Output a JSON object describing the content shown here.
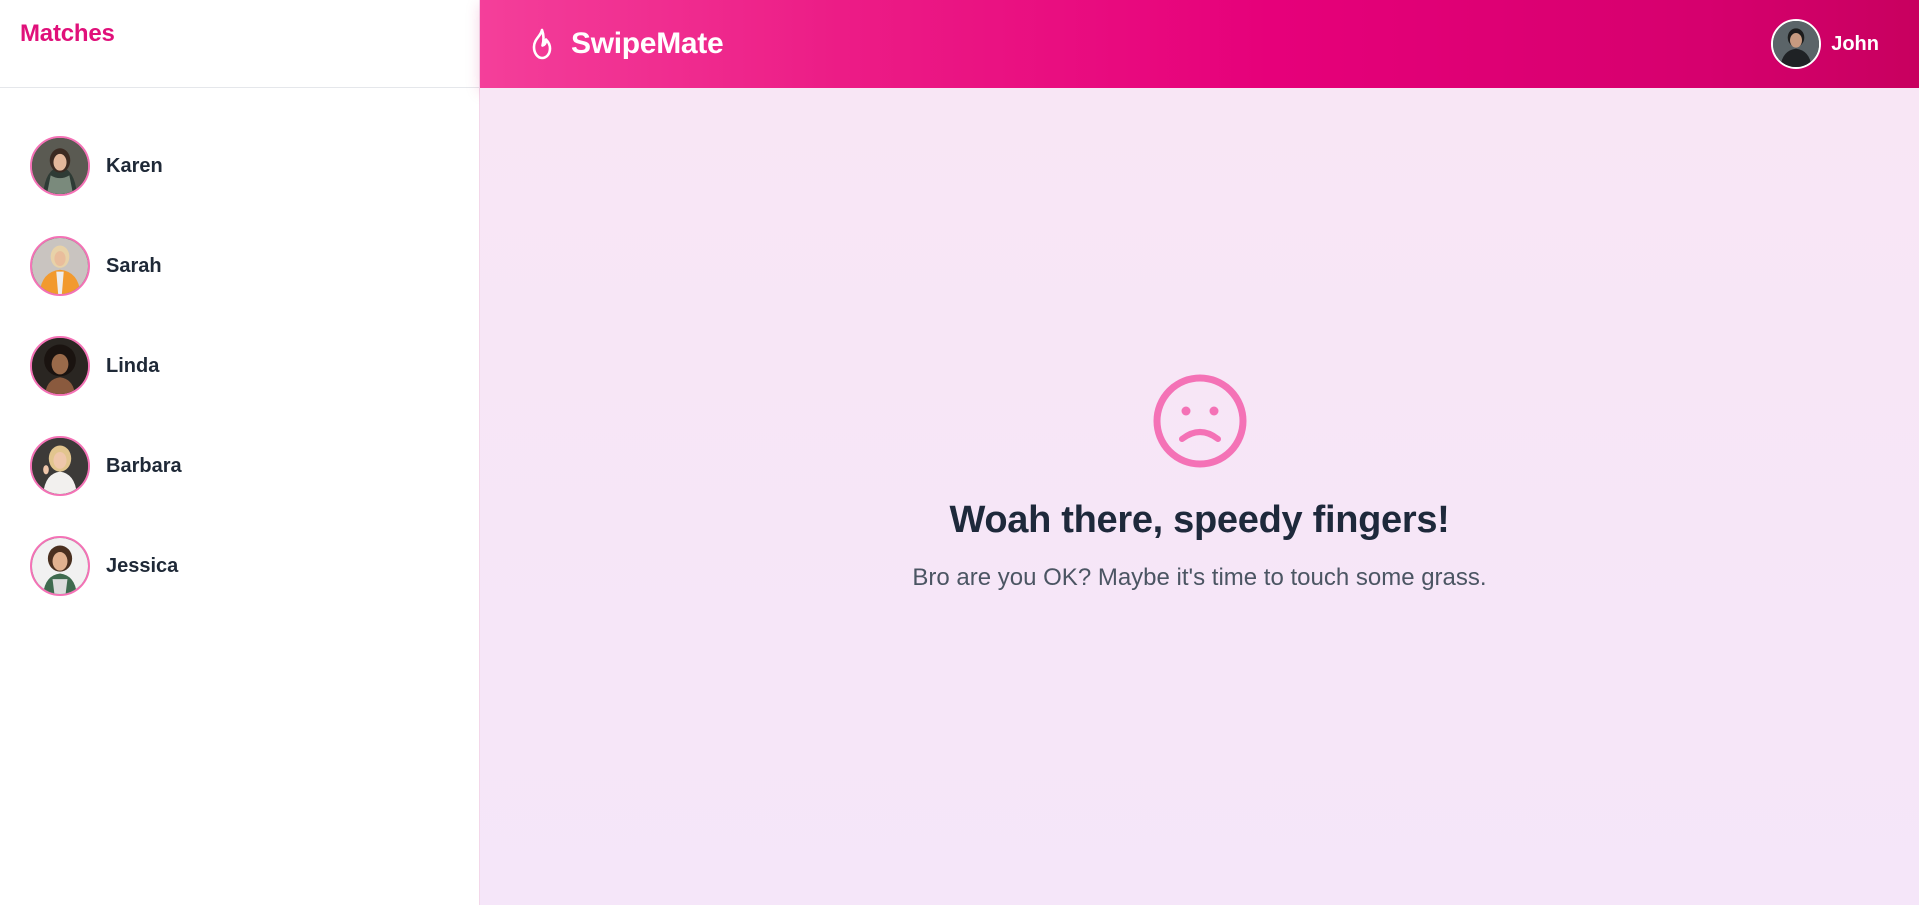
{
  "sidebar": {
    "title": "Matches",
    "matches": [
      {
        "name": "Karen"
      },
      {
        "name": "Sarah"
      },
      {
        "name": "Linda"
      },
      {
        "name": "Barbara"
      },
      {
        "name": "Jessica"
      }
    ]
  },
  "header": {
    "app_name": "SwipeMate",
    "logo_icon": "flame-icon",
    "user": {
      "name": "John"
    }
  },
  "main": {
    "empty_state": {
      "icon": "sad-face-icon",
      "title": "Woah there, speedy fingers!",
      "subtitle": "Bro are you OK? Maybe it's time to touch some grass."
    }
  },
  "colors": {
    "accent": "#e0107a",
    "header_gradient_start": "#f43f9a",
    "header_gradient_end": "#c8005f",
    "icon_pink": "#f472b6",
    "background": "#f6e6f7"
  }
}
